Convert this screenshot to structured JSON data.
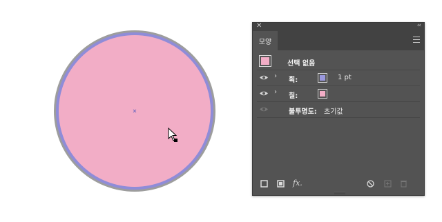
{
  "canvas": {
    "circle_fill": "#f2adc6",
    "circle_stroke": "#8f8cd8",
    "circle_outer": "#9d9d9d",
    "center_mark_color": "#7a6fbf"
  },
  "panel": {
    "close_symbol": "✕",
    "collapse_symbol": "‹‹",
    "tab_label": "모양",
    "header_label": "선택 없음",
    "stroke_label": "획:",
    "stroke_value": "1 pt",
    "fill_label": "칠:",
    "opacity_label": "불투명도:",
    "opacity_value": "초기값",
    "fx_label": "fx.",
    "fill_swatch_color": "#f2adc6",
    "stroke_swatch_color": "#9a98dd"
  }
}
